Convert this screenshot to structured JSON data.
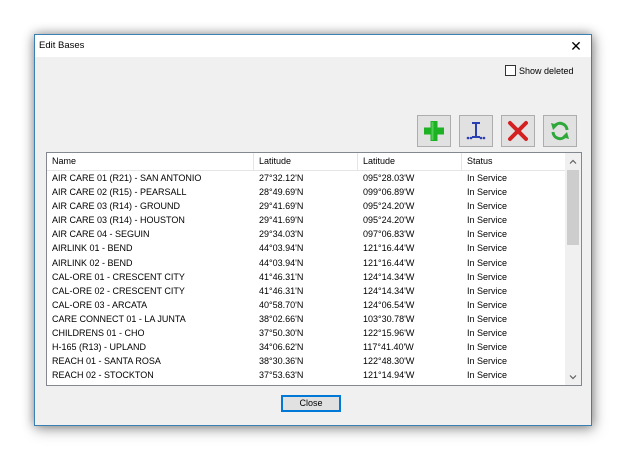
{
  "window": {
    "title": "Edit Bases",
    "close_glyph": "✕"
  },
  "options": {
    "show_deleted_label": "Show deleted",
    "show_deleted_checked": false
  },
  "toolbar": [
    {
      "name": "add-button",
      "icon": "plus-icon",
      "color": "#1db124"
    },
    {
      "name": "edit-button",
      "icon": "edit-fields-icon",
      "color": "#2b3fb5"
    },
    {
      "name": "delete-button",
      "icon": "delete-x-icon",
      "color": "#d42020"
    },
    {
      "name": "refresh-button",
      "icon": "refresh-icon",
      "color": "#2ea83a"
    }
  ],
  "table": {
    "columns": [
      "Name",
      "Latitude",
      "Latitude",
      "Status"
    ],
    "rows": [
      [
        "AIR CARE 01 (R21) - SAN ANTONIO",
        "27°32.12'N",
        "095°28.03'W",
        "In Service"
      ],
      [
        "AIR CARE 02 (R15) - PEARSALL",
        "28°49.69'N",
        "099°06.89'W",
        "In Service"
      ],
      [
        "AIR CARE 03 (R14) - GROUND",
        "29°41.69'N",
        "095°24.20'W",
        "In Service"
      ],
      [
        "AIR CARE 03 (R14) - HOUSTON",
        "29°41.69'N",
        "095°24.20'W",
        "In Service"
      ],
      [
        "AIR CARE 04 - SEGUIN",
        "29°34.03'N",
        "097°06.83'W",
        "In Service"
      ],
      [
        "AIRLINK 01 - BEND",
        "44°03.94'N",
        "121°16.44'W",
        "In Service"
      ],
      [
        "AIRLINK 02 - BEND",
        "44°03.94'N",
        "121°16.44'W",
        "In Service"
      ],
      [
        "CAL-ORE 01 - CRESCENT CITY",
        "41°46.31'N",
        "124°14.34'W",
        "In Service"
      ],
      [
        "CAL-ORE 02 - CRESCENT CITY",
        "41°46.31'N",
        "124°14.34'W",
        "In Service"
      ],
      [
        "CAL-ORE 03 - ARCATA",
        "40°58.70'N",
        "124°06.54'W",
        "In Service"
      ],
      [
        "CARE CONNECT 01 - LA JUNTA",
        "38°02.66'N",
        "103°30.78'W",
        "In Service"
      ],
      [
        "CHILDRENS 01 - CHO",
        "37°50.30'N",
        "122°15.96'W",
        "In Service"
      ],
      [
        "H-165 (R13) - UPLAND",
        "34°06.62'N",
        "117°41.40'W",
        "In Service"
      ],
      [
        "REACH 01 - SANTA ROSA",
        "38°30.36'N",
        "122°48.30'W",
        "In Service"
      ],
      [
        "REACH 02 - STOCKTON",
        "37°53.63'N",
        "121°14.94'W",
        "In Service"
      ]
    ]
  },
  "footer": {
    "close_label": "Close"
  }
}
